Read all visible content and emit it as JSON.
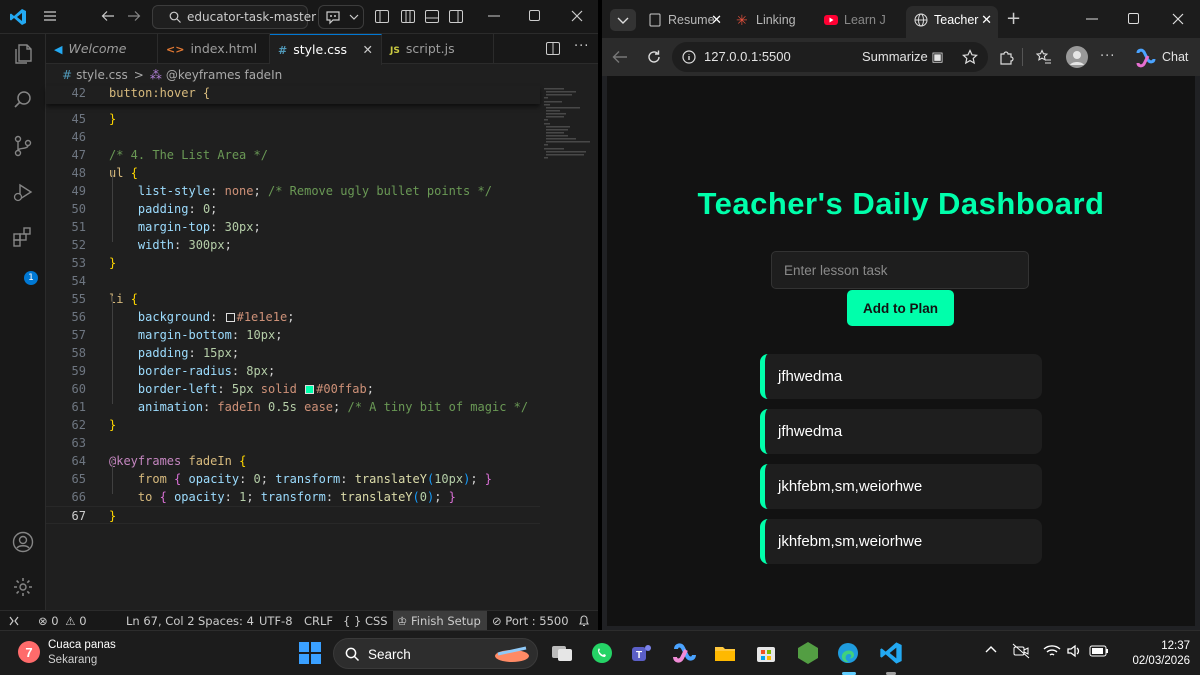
{
  "vscode": {
    "search_text": "educator-task-master",
    "tabs": [
      {
        "label": "Welcome",
        "icon": "vscode-icon"
      },
      {
        "label": "index.html",
        "icon": "html-icon"
      },
      {
        "label": "style.css",
        "icon": "css-icon"
      },
      {
        "label": "script.js",
        "icon": "js-icon"
      }
    ],
    "breadcrumb": {
      "file": "style.css",
      "symbol": "@keyframes fadeIn"
    },
    "sticky_line_number": "42",
    "sticky_line_code": "button:hover {",
    "line_numbers": [
      "45",
      "46",
      "47",
      "48",
      "49",
      "50",
      "51",
      "52",
      "53",
      "54",
      "55",
      "56",
      "57",
      "58",
      "59",
      "60",
      "61",
      "62",
      "63",
      "64",
      "65",
      "66",
      "67"
    ],
    "code": {
      "l45": "}",
      "l47": "/* 4. The List Area */",
      "l48_sel": "ul",
      "l49_prop": "list-style",
      "l49_val": "none",
      "l49_com": "/* Remove ugly bullet points */",
      "l50_prop": "padding",
      "l50_val": "0",
      "l51_prop": "margin-top",
      "l51_val": "30px",
      "l52_prop": "width",
      "l52_val": "300px",
      "l55_sel": "li",
      "l56_prop": "background",
      "l56_val": "#1e1e1e",
      "l57_prop": "margin-bottom",
      "l57_val": "10px",
      "l58_prop": "padding",
      "l58_val": "15px",
      "l59_prop": "border-radius",
      "l59_val": "8px",
      "l60_prop": "border-left",
      "l60_val1": "5px",
      "l60_val2": "solid",
      "l60_val3": "#00ffab",
      "l61_prop": "animation",
      "l61_val1": "fadeIn",
      "l61_val2": "0.5s",
      "l61_val3": "ease",
      "l61_com": "/* A tiny bit of magic */",
      "l64_kw": "@keyframes",
      "l64_name": "fadeIn",
      "l65_from": "from",
      "l65_p1": "opacity",
      "l65_v1": "0",
      "l65_p2": "transform",
      "l65_fn": "translateY",
      "l65_arg": "10px",
      "l66_to": "to",
      "l66_p1": "opacity",
      "l66_v1": "1",
      "l66_p2": "transform",
      "l66_fn": "translateY",
      "l66_arg": "0"
    },
    "activity_badge": "1",
    "status": {
      "errors": "0",
      "warnings": "0",
      "position": "Ln 67, Col 2",
      "spaces": "Spaces: 4",
      "encoding": "UTF-8",
      "eol": "CRLF",
      "language": "CSS",
      "finish_setup": "Finish Setup",
      "port": "Port : 5500"
    }
  },
  "browser": {
    "tabs": [
      {
        "label": "Resume"
      },
      {
        "label": "Linking"
      },
      {
        "label": "Learn J"
      },
      {
        "label": "Teacher"
      }
    ],
    "url": "127.0.0.1:5500",
    "summarize": "Summarize",
    "chat": "Chat",
    "page": {
      "title": "Teacher's Daily Dashboard",
      "input_placeholder": "Enter lesson task",
      "button": "Add to Plan",
      "tasks": [
        "jfhwedma",
        "jfhwedma",
        "jkhfebm,sm,weiorhwe",
        "jkhfebm,sm,weiorhwe"
      ]
    },
    "colors": {
      "accent": "#00ffab",
      "page_bg": "#121212",
      "item_bg": "#1e1e1e"
    }
  },
  "taskbar": {
    "weather_title": "Cuaca panas",
    "weather_sub": "Sekarang",
    "weather_badge": "7",
    "search": "Search",
    "time": "12:37",
    "date": "02/03/2026"
  }
}
